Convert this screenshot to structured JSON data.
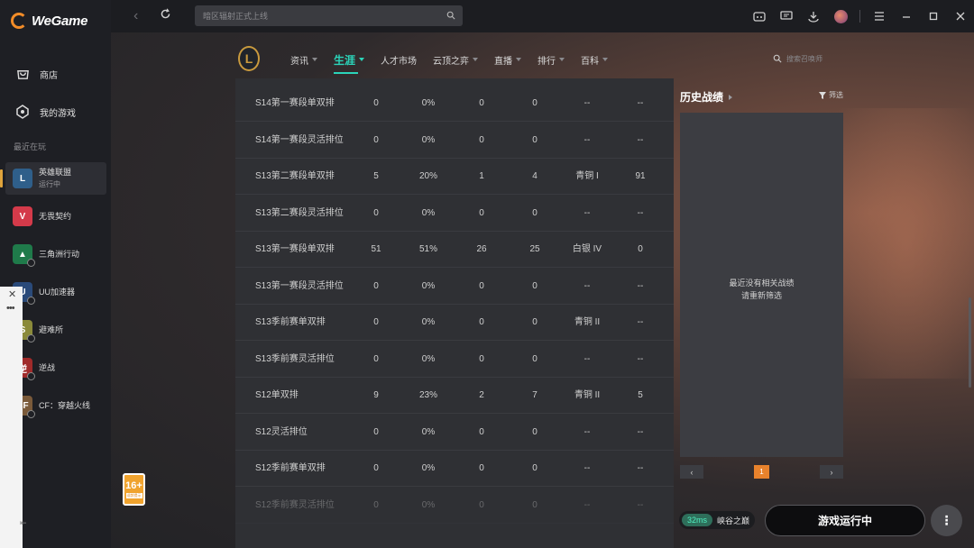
{
  "app": {
    "name": "WeGame"
  },
  "sidebar": {
    "nav": [
      {
        "label": "商店",
        "icon": "store-icon"
      },
      {
        "label": "我的游戏",
        "icon": "my-games-icon"
      }
    ],
    "recent_title": "最近在玩",
    "games": [
      {
        "name": "英雄联盟",
        "status": "运行中",
        "color": "#2f5f8a"
      },
      {
        "name": "无畏契约",
        "status": "",
        "color": "#d43a4a"
      },
      {
        "name": "三角洲行动",
        "status": "",
        "color": "#1f7a4a"
      },
      {
        "name": "UU加速器",
        "status": "",
        "color": "#2a4a7a"
      },
      {
        "name": "避难所",
        "status": "",
        "color": "#8a8a3a"
      },
      {
        "name": "逆战",
        "status": "",
        "color": "#a02a2a"
      },
      {
        "name": "CF：穿越火线",
        "status": "",
        "color": "#7a5a3a"
      }
    ]
  },
  "topbar": {
    "search_placeholder": "暗区辐射正式上线"
  },
  "game_nav": {
    "logo_text": "L",
    "tabs": [
      {
        "label": "资讯",
        "has_caret": true,
        "active": false
      },
      {
        "label": "生涯",
        "has_caret": true,
        "active": true
      },
      {
        "label": "人才市场",
        "has_caret": false,
        "active": false
      },
      {
        "label": "云顶之弈",
        "has_caret": true,
        "active": false
      },
      {
        "label": "直播",
        "has_caret": true,
        "active": false
      },
      {
        "label": "排行",
        "has_caret": true,
        "active": false
      },
      {
        "label": "百科",
        "has_caret": true,
        "active": false
      }
    ],
    "summoner_search_placeholder": "搜索召唤师"
  },
  "stats": {
    "rows": [
      [
        "S14第一赛段单双排",
        "0",
        "0%",
        "0",
        "0",
        "--",
        "--"
      ],
      [
        "S14第一赛段灵活排位",
        "0",
        "0%",
        "0",
        "0",
        "--",
        "--"
      ],
      [
        "S13第二赛段单双排",
        "5",
        "20%",
        "1",
        "4",
        "青铜 I",
        "91"
      ],
      [
        "S13第二赛段灵活排位",
        "0",
        "0%",
        "0",
        "0",
        "--",
        "--"
      ],
      [
        "S13第一赛段单双排",
        "51",
        "51%",
        "26",
        "25",
        "白银 IV",
        "0"
      ],
      [
        "S13第一赛段灵活排位",
        "0",
        "0%",
        "0",
        "0",
        "--",
        "--"
      ],
      [
        "S13季前赛单双排",
        "0",
        "0%",
        "0",
        "0",
        "青铜 II",
        "--"
      ],
      [
        "S13季前赛灵活排位",
        "0",
        "0%",
        "0",
        "0",
        "--",
        "--"
      ],
      [
        "S12单双排",
        "9",
        "23%",
        "2",
        "7",
        "青铜 II",
        "5"
      ],
      [
        "S12灵活排位",
        "0",
        "0%",
        "0",
        "0",
        "--",
        "--"
      ],
      [
        "S12季前赛单双排",
        "0",
        "0%",
        "0",
        "0",
        "--",
        "--"
      ],
      [
        "S12季前赛灵活排位",
        "0",
        "0%",
        "0",
        "0",
        "--",
        "--"
      ]
    ]
  },
  "history": {
    "title": "历史战绩",
    "filter_label": "筛选",
    "empty_line1": "最近没有相关战绩",
    "empty_line2": "请重新筛选",
    "page": "1",
    "prev": "‹",
    "next": "›"
  },
  "bottom": {
    "ping": "32ms",
    "server": "峡谷之巅",
    "run_label": "游戏运行中",
    "more_label": "⋮"
  },
  "age_rating": {
    "label": "16+",
    "sub": "适龄提示"
  }
}
